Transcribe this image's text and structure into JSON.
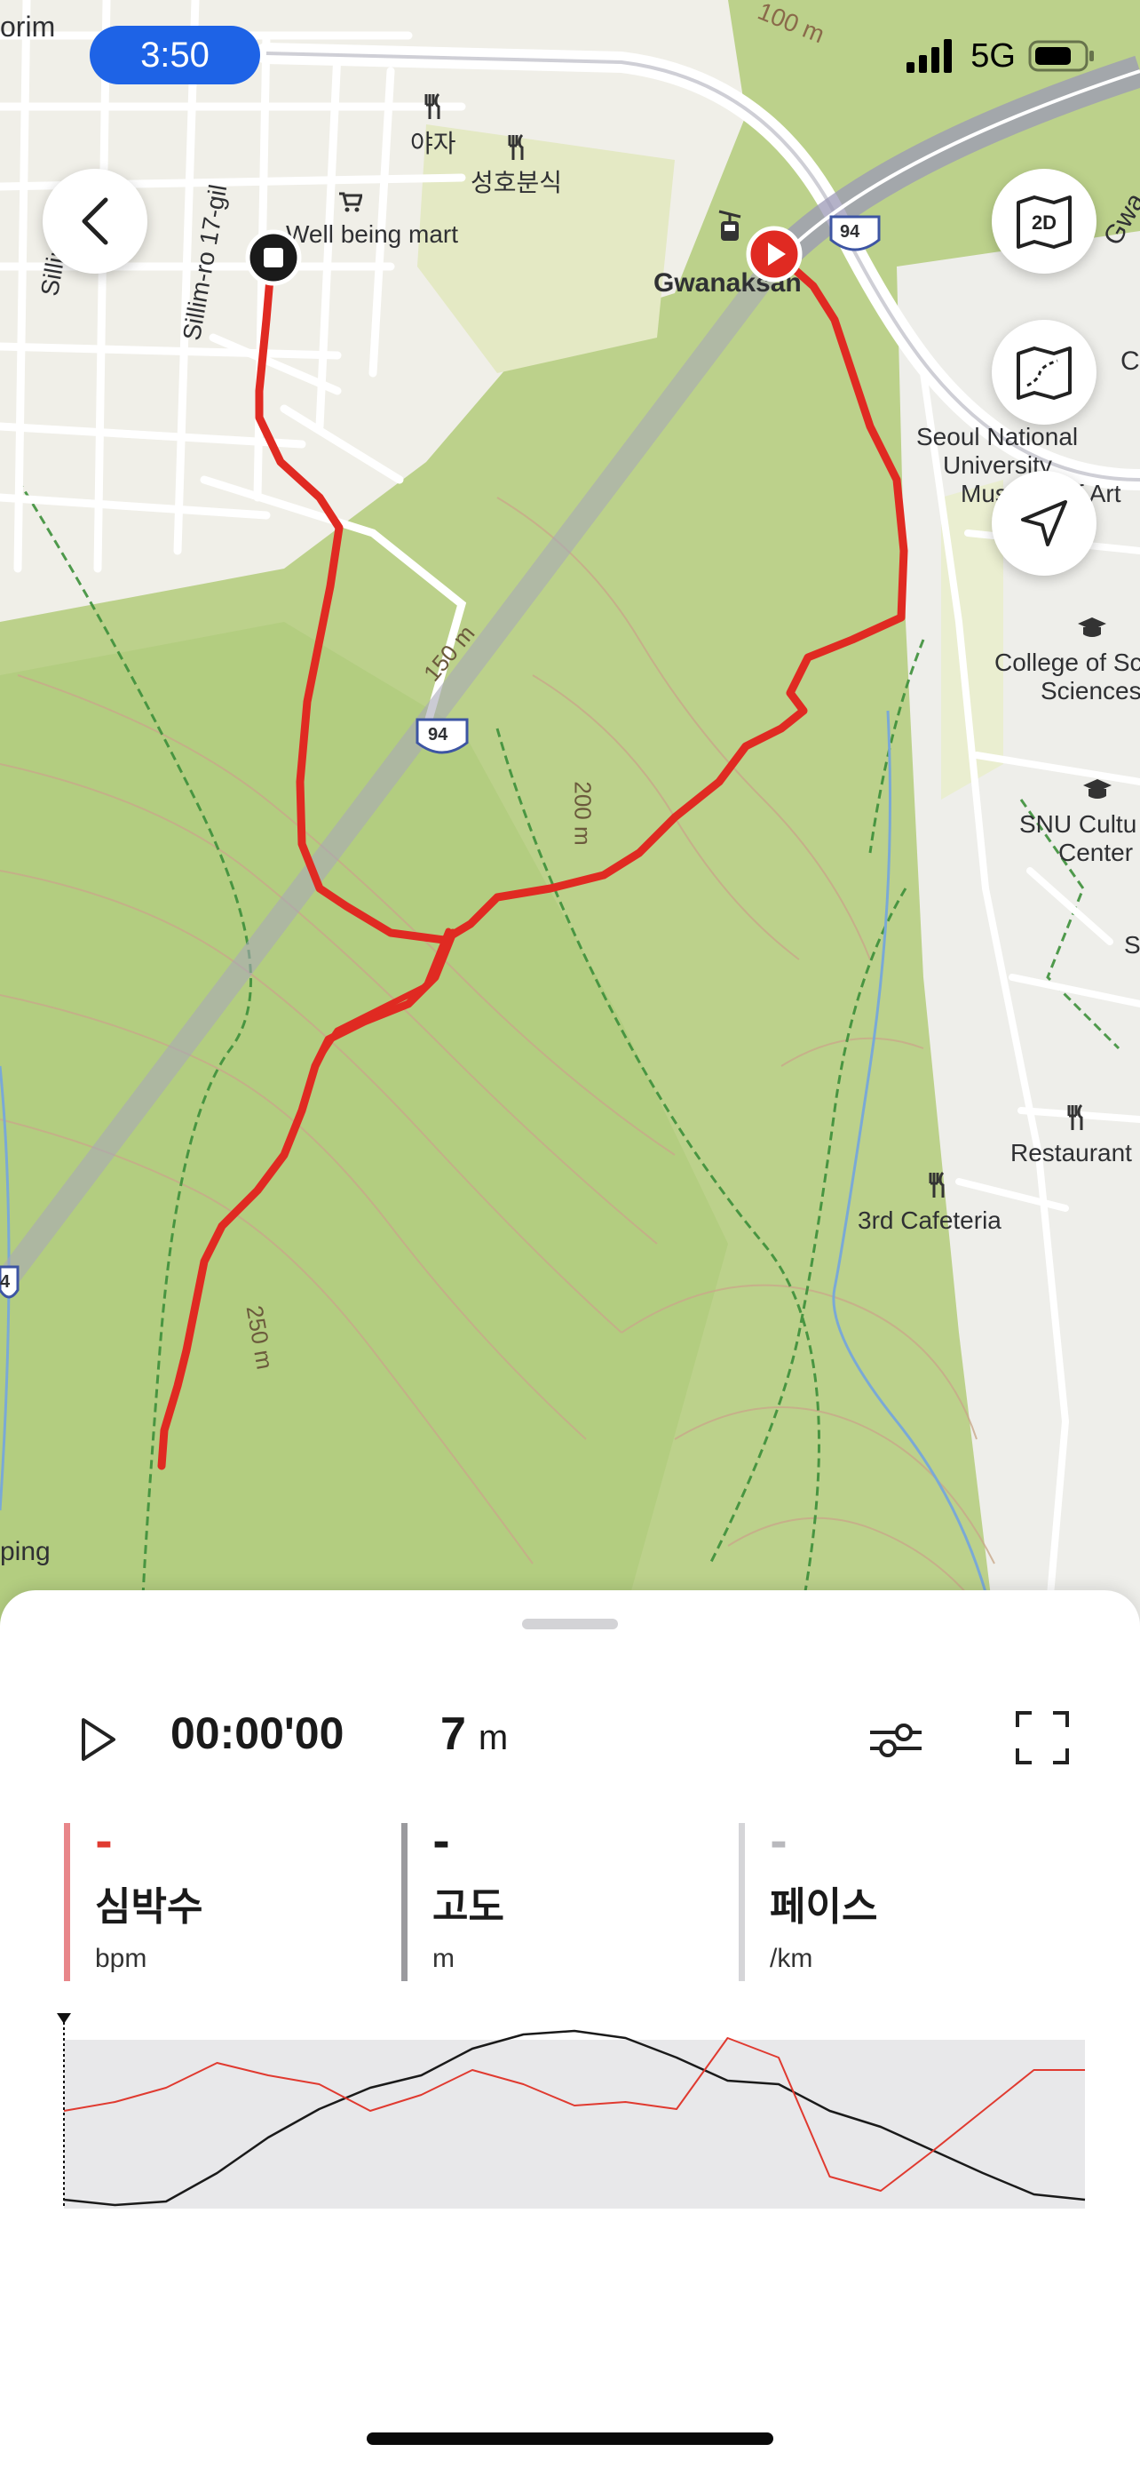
{
  "status_bar": {
    "time": "3:50",
    "network": "5G"
  },
  "map": {
    "labels": {
      "top_left_fragment": "orim",
      "contour_100": "100 m",
      "yaja": "야자",
      "snack_shop": "성호분식",
      "mart": "Well being mart",
      "road_sillim": "Sillim-ro",
      "road_sillim17": "Sillim-ro 17-gil",
      "gwanaksan": "Gwanaksan",
      "route_94": "94",
      "gwa_fragment": "Gwa",
      "c_fragment": "C",
      "museum_1": "Seoul National",
      "museum_2": "University",
      "museum_3": "Museum of Art",
      "college_1": "College of Sci",
      "college_2": "Sciences",
      "contour_150": "150 m",
      "contour_200": "200 m",
      "contour_250": "250 m",
      "snu_culture_1": "SNU Cultu",
      "snu_culture_2": "Center",
      "s_fragment": "S",
      "restaurant": "Restaurant",
      "cafeteria": "3rd Cafeteria",
      "left_fragment": "4",
      "bottom_left_fragment": "ping"
    },
    "buttons": {
      "back": "back",
      "view_2d": "2D",
      "map_style": "map-style",
      "locate": "locate"
    },
    "track_color": "#e02a22",
    "start_marker_color": "#e02a22",
    "end_marker_color": "#1a1a1a"
  },
  "playback": {
    "elapsed": "00:00'00",
    "distance_value": "7",
    "distance_unit": "m"
  },
  "metrics": [
    {
      "value": "-",
      "label": "심박수",
      "unit": "bpm",
      "color": "#e8868a",
      "value_color": "#e03a30"
    },
    {
      "value": "-",
      "label": "고도",
      "unit": "m",
      "color": "#9a9a9e",
      "value_color": "#1a1a1a"
    },
    {
      "value": "-",
      "label": "페이스",
      "unit": "/km",
      "color": "#d5d5d8",
      "value_color": "#b9b9bd"
    }
  ],
  "chart_data": {
    "type": "line",
    "x": [
      0,
      0.05,
      0.1,
      0.15,
      0.2,
      0.25,
      0.3,
      0.35,
      0.4,
      0.45,
      0.5,
      0.55,
      0.6,
      0.65,
      0.7,
      0.75,
      0.8,
      0.85,
      0.9,
      0.95,
      1.0
    ],
    "series": [
      {
        "color": "#1a1a1a",
        "values": [
          0.05,
          0.02,
          0.04,
          0.2,
          0.4,
          0.56,
          0.68,
          0.75,
          0.9,
          0.98,
          1.0,
          0.96,
          0.85,
          0.72,
          0.7,
          0.55,
          0.46,
          0.33,
          0.2,
          0.08,
          0.05
        ]
      },
      {
        "color": "#e03a30",
        "values": [
          0.55,
          0.6,
          0.68,
          0.82,
          0.75,
          0.7,
          0.55,
          0.64,
          0.78,
          0.7,
          0.58,
          0.6,
          0.56,
          0.96,
          0.85,
          0.18,
          0.1,
          0.32,
          0.55,
          0.78,
          0.78
        ]
      }
    ],
    "background_fill": "#e8e8ea"
  }
}
